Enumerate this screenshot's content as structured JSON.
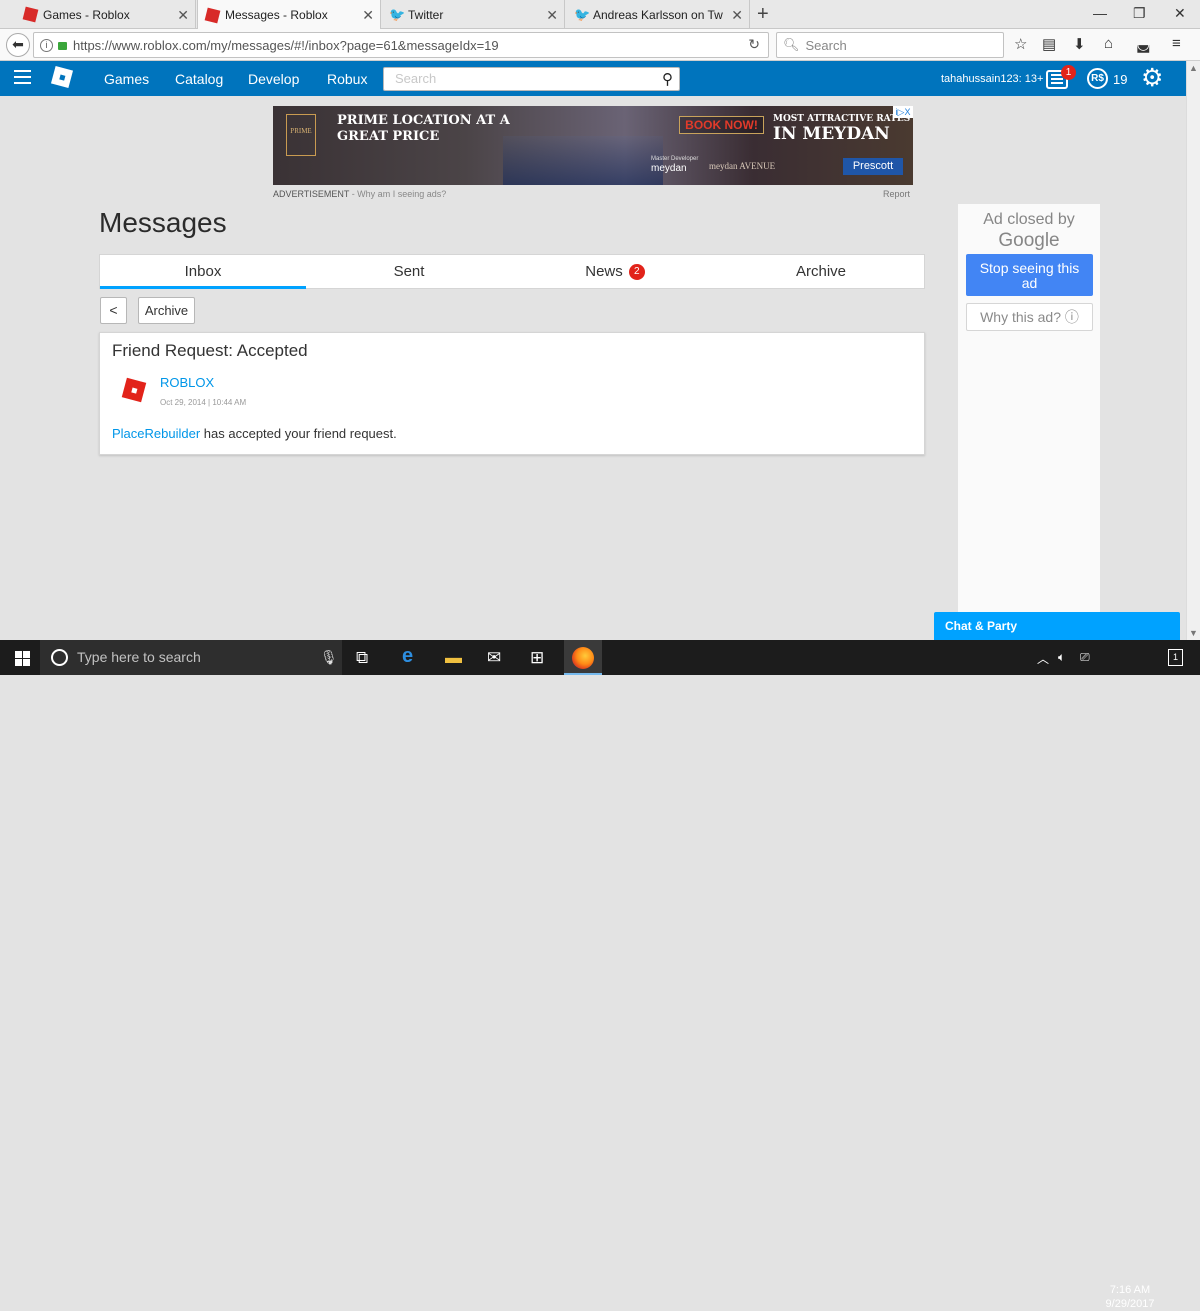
{
  "browser": {
    "tabs": [
      {
        "title": "Games - Roblox",
        "favicon": "roblox-icon",
        "active": false
      },
      {
        "title": "Messages - Roblox",
        "favicon": "roblox-icon",
        "active": true
      },
      {
        "title": "Twitter",
        "favicon": "twitter-icon",
        "active": false
      },
      {
        "title": "Andreas Karlsson on Twitter",
        "favicon": "twitter-icon",
        "active": false
      }
    ],
    "new_tab": "+",
    "url": "https://www.roblox.com/my/messages/#!/inbox?page=61&messageIdx=19",
    "search_placeholder": "Search"
  },
  "roblox_nav": {
    "links": [
      "Games",
      "Catalog",
      "Develop",
      "Robux"
    ],
    "search_placeholder": "Search",
    "username": "tahahussain123: 13+",
    "message_count": "1",
    "robux_symbol": "R$",
    "robux": "19"
  },
  "ad": {
    "headline": "PRIME LOCATION AT A GREAT PRICE",
    "logo_text": "PRIME",
    "book_now": "BOOK NOW!",
    "tagline": "MOST ATTRACTIVE RATES",
    "location": "IN MEYDAN",
    "developer_label": "Master Developer",
    "brand": "meydan",
    "avenue": "meydan AVENUE",
    "agent": "Prescott",
    "caption": "ADVERTISEMENT",
    "caption_link": " - Why am I seeing ads?",
    "report": "Report",
    "adchoices": "i▷X"
  },
  "page": {
    "title": "Messages",
    "tabs": [
      {
        "label": "Inbox",
        "active": true
      },
      {
        "label": "Sent",
        "active": false
      },
      {
        "label": "News",
        "active": false,
        "badge": "2"
      },
      {
        "label": "Archive",
        "active": false
      }
    ],
    "back_label": "<",
    "archive_button": "Archive"
  },
  "message": {
    "subject": "Friend Request: Accepted",
    "sender": "ROBLOX",
    "date": "Oct 29, 2014 | 10:44 AM",
    "body_link": "PlaceRebuilder",
    "body_text": " has accepted your friend request."
  },
  "side_ad": {
    "closed_by": "Ad closed by",
    "google": "Google",
    "stop_line1": "Stop seeing this",
    "stop_line2": "ad",
    "why": "Why this ad? ⓘ"
  },
  "chat": {
    "label": "Chat & Party"
  },
  "taskbar": {
    "search_placeholder": "Type here to search",
    "time": "7:16 AM",
    "date": "9/29/2017",
    "notifications": "1"
  }
}
